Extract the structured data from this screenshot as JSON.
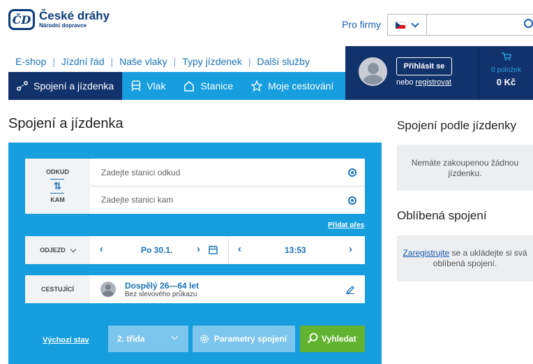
{
  "header": {
    "logo_mark": "ČD",
    "logo_name": "České dráhy",
    "logo_sub": "Národní dopravce",
    "pro_firmy": "Pro firmy"
  },
  "topnav": [
    "E-shop",
    "Jízdní řád",
    "Naše vlaky",
    "Typy jízdenek",
    "Další služby"
  ],
  "user": {
    "login_label": "Přihlásit se",
    "or_text": "nebo ",
    "register_label": "registrovat",
    "cart_count": "0 položek",
    "cart_price": "0 Kč"
  },
  "mainnav": [
    {
      "label": "Spojení a jízdenka",
      "icon": "route-icon"
    },
    {
      "label": "Vlak",
      "icon": "train-icon"
    },
    {
      "label": "Stanice",
      "icon": "station-icon"
    },
    {
      "label": "Moje cestování",
      "icon": "star-icon"
    }
  ],
  "page_title": "Spojení a jízdenka",
  "form": {
    "from_label": "ODKUD",
    "to_label": "KAM",
    "from_placeholder": "Zadejte stanici odkud",
    "to_placeholder": "Zadejte stanici kam",
    "add_via": "Přidat přes",
    "departure_label": "ODJEZD",
    "date": "Po 30.1.",
    "time": "13:53",
    "passengers_label": "CESTUJÍCÍ",
    "passenger_type": "Dospělý 26—64 let",
    "passenger_discount": "Bez slevového průkazu",
    "reset_link": "Výchozí stav",
    "class_select": "2. třída",
    "params_button": "Parametry spojení",
    "search_button": "Vyhledat"
  },
  "sidebar": {
    "tickets_title": "Spojení podle jízdenky",
    "tickets_empty": "Nemáte zakoupenou žádnou jízdenku.",
    "fav_title": "Oblíbená spojení",
    "fav_link": "Zaregistrujte",
    "fav_text": " se a ukládejte si svá oblíbená spojení."
  },
  "colors": {
    "brand_dark": "#12326b",
    "brand_blue": "#169ede",
    "search_green": "#62b32f"
  }
}
